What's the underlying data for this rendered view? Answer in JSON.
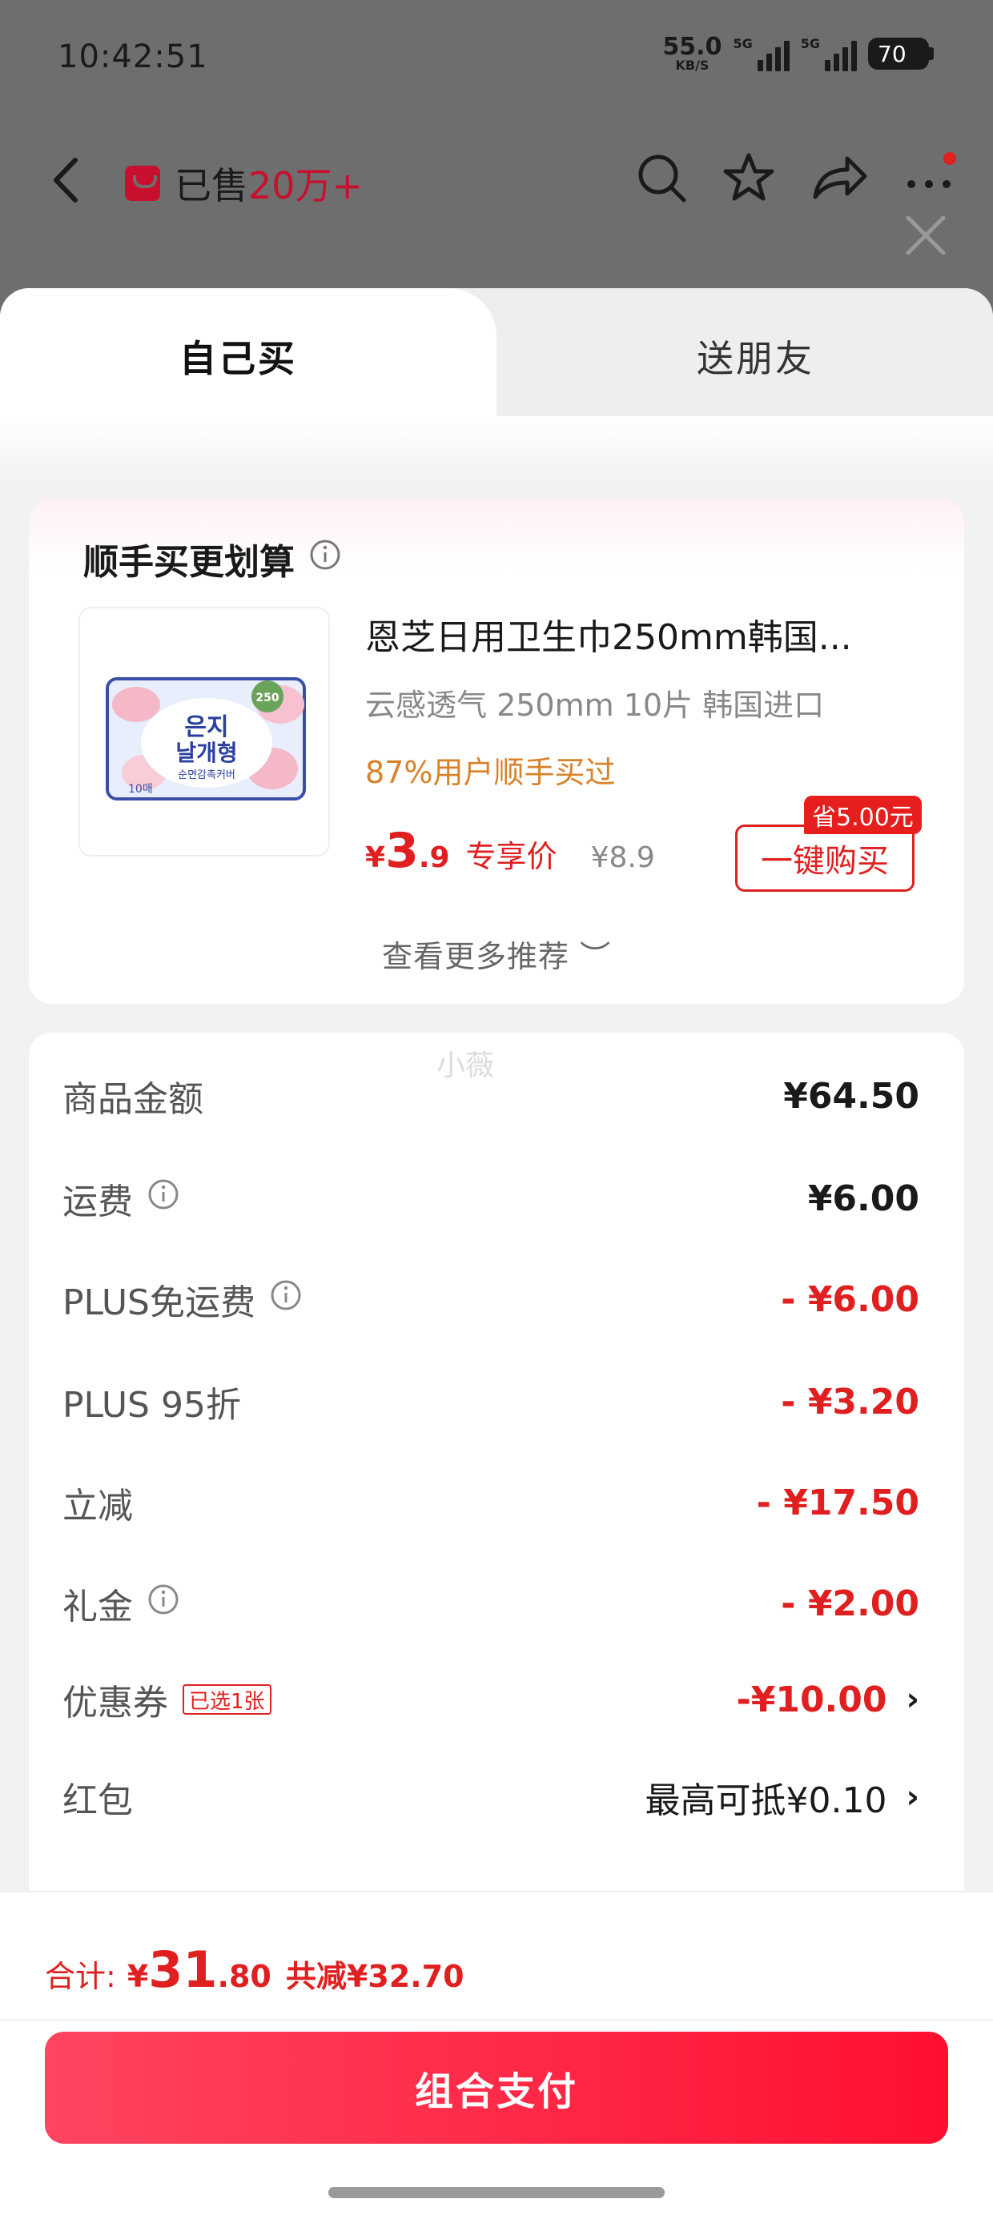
{
  "status_bar": {
    "time": "10:42:51",
    "net_speed": "55.0",
    "net_unit": "KB/S",
    "sim1": "5G",
    "sim2": "5G",
    "battery": "70"
  },
  "nav": {
    "sold_label": "已售",
    "sold_count": "20万+",
    "icons": [
      "back-icon",
      "search-icon",
      "star-icon",
      "share-icon",
      "more-icon",
      "close-icon"
    ]
  },
  "tabs": {
    "self": "自己买",
    "friend": "送朋友"
  },
  "recommend": {
    "title": "顺手买更划算",
    "product_name": "恩芝日用卫生巾250mm韩国...",
    "spec": "云感透气 250mm 10片 韩国进口",
    "rate": "87%用户顺手买过",
    "price_yen": "¥",
    "price_int": "3",
    "price_dec": ".9",
    "exclusive": "专享价",
    "orig_price": "¥8.9",
    "save_badge": "省5.00元",
    "buy_button": "一键购买",
    "more": "查看更多推荐 ︶",
    "pkg": {
      "badge": "250",
      "line1": "은지",
      "line2": "날개형",
      "line3": "순면감촉커버",
      "count": "10매"
    }
  },
  "watermark": "小薇",
  "fees": {
    "goods_label": "商品金额",
    "goods_val": "¥64.50",
    "ship_label": "运费",
    "ship_val": "¥6.00",
    "plus_free_label": "PLUS免运费",
    "plus_free_val": "- ¥6.00",
    "plus_disc_label": "PLUS 95折",
    "plus_disc_val": "- ¥3.20",
    "instant_label": "立减",
    "instant_val": "- ¥17.50",
    "gift_label": "礼金",
    "gift_val": "- ¥2.00",
    "coupon_label": "优惠券",
    "coupon_tag": "已选1张",
    "coupon_val": "-¥10.00",
    "redpacket_label": "红包",
    "redpacket_val": "最高可抵¥0.10",
    "chevron": "›"
  },
  "bottom": {
    "total_label": "合计:",
    "total_yen": "¥",
    "total_int": "31",
    "total_dec": ".80",
    "total_off": "共减¥32.70",
    "pay_button": "组合支付"
  },
  "colors": {
    "accent": "#e02020",
    "orange": "#d9822b",
    "pay_gradient": [
      "#ff4560",
      "#ff1030"
    ]
  }
}
